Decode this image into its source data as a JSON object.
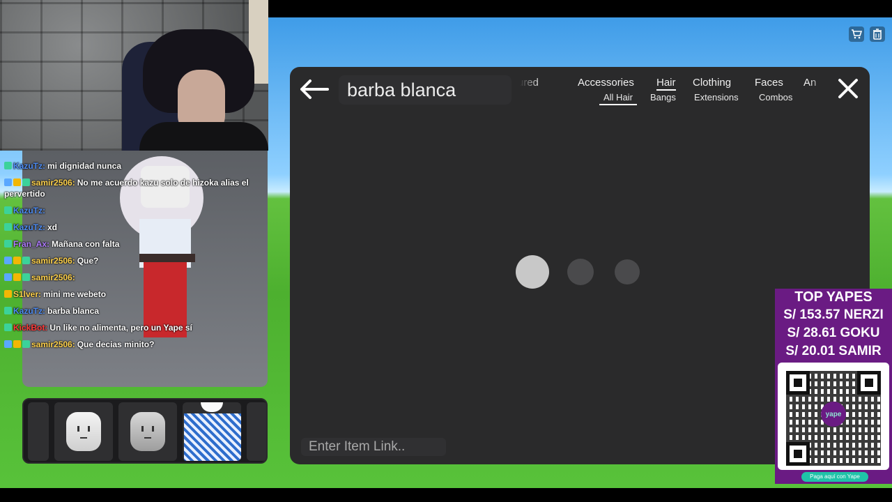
{
  "chat": [
    {
      "user": "KazuTz",
      "user_color": "#4f8df5",
      "badges": [
        "green"
      ],
      "text": "mi dignidad nunca"
    },
    {
      "user": "samir2506",
      "user_color": "#ffd24d",
      "badges": [
        "blue",
        "gold",
        "green"
      ],
      "text": "No me acuerdo kazu solo de hizoka alias el pervertido"
    },
    {
      "user": "KazuTz",
      "user_color": "#4f8df5",
      "badges": [
        "green"
      ],
      "text": ""
    },
    {
      "user": "KazuTz",
      "user_color": "#4f8df5",
      "badges": [
        "green"
      ],
      "text": "xd"
    },
    {
      "user": "Fran_Ax",
      "user_color": "#b07cff",
      "badges": [
        "green"
      ],
      "text": "Mañana con falta"
    },
    {
      "user": "samir2506",
      "user_color": "#ffd24d",
      "badges": [
        "blue",
        "gold",
        "green"
      ],
      "text": "Que?"
    },
    {
      "user": "samir2506",
      "user_color": "#ffd24d",
      "badges": [
        "blue",
        "gold",
        "green"
      ],
      "text": ""
    },
    {
      "user": "S1lver",
      "user_color": "#ffd24d",
      "badges": [
        "gold"
      ],
      "text": "mini me webeto"
    },
    {
      "user": "KazuTz",
      "user_color": "#4f8df5",
      "badges": [
        "green"
      ],
      "text": "barba blanca"
    },
    {
      "user": "KickBot",
      "user_color": "#ff3b3b",
      "badges": [
        "green"
      ],
      "text": "Un like no alimenta, pero un Yape sí"
    },
    {
      "user": "samir2506",
      "user_color": "#ffd24d",
      "badges": [
        "blue",
        "gold",
        "green"
      ],
      "text": "Que decias minito?"
    }
  ],
  "catalog": {
    "search_value": "barba blanca",
    "tabs": [
      {
        "label": "Featured",
        "display": "eatured"
      },
      {
        "label": "Accessories"
      },
      {
        "label": "Hair",
        "active": true
      },
      {
        "label": "Clothing"
      },
      {
        "label": "Faces"
      },
      {
        "label": "Animations",
        "display": "An"
      }
    ],
    "subtabs": [
      {
        "label": "All Hair",
        "active": true
      },
      {
        "label": "Bangs"
      },
      {
        "label": "Extensions"
      },
      {
        "label": "Combos"
      }
    ],
    "item_link_placeholder": "Enter Item Link.."
  },
  "yapes": {
    "title": "TOP YAPES",
    "rows": [
      "S/ 153.57 NERZI",
      "S/ 28.61 GOKU",
      "S/ 20.01 SAMIR"
    ],
    "qr_caption": "Paga aquí con Yape",
    "logo_text": "yape"
  },
  "icons": {
    "top_right": [
      "cart-icon",
      "trash-icon"
    ]
  },
  "colors": {
    "modal_bg": "#2a2a2b",
    "yapes_purple": "#6a1b83",
    "loader_active": "#c8c8c8",
    "loader_idle": "#4a4a4c"
  }
}
